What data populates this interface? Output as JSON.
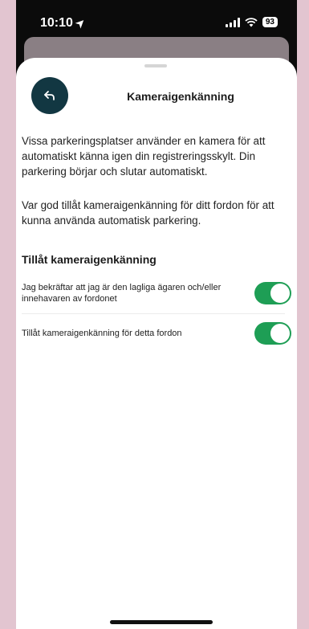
{
  "status_bar": {
    "time": "10:10",
    "battery": "93"
  },
  "header": {
    "title": "Kameraigenkänning",
    "back_icon": "back-arrow-icon"
  },
  "content": {
    "paragraph1": "Vissa parkeringsplatser använder en kamera för att automatiskt känna igen din registreringsskylt. Din parkering börjar och slutar automatiskt.",
    "paragraph2": "Var god tillåt kameraigenkänning för ditt fordon för att kunna använda automatisk parkering.",
    "section_title": "Tillåt kameraigenkänning",
    "toggles": [
      {
        "label": "Jag bekräftar att jag är den lagliga ägaren och/eller innehavaren av fordonet",
        "on": true
      },
      {
        "label": "Tillåt kameraigenkänning för detta fordon",
        "on": true
      }
    ]
  },
  "colors": {
    "accent_green": "#1e9e55",
    "back_button": "#123742",
    "backdrop_pink": "#e2c5d0"
  }
}
